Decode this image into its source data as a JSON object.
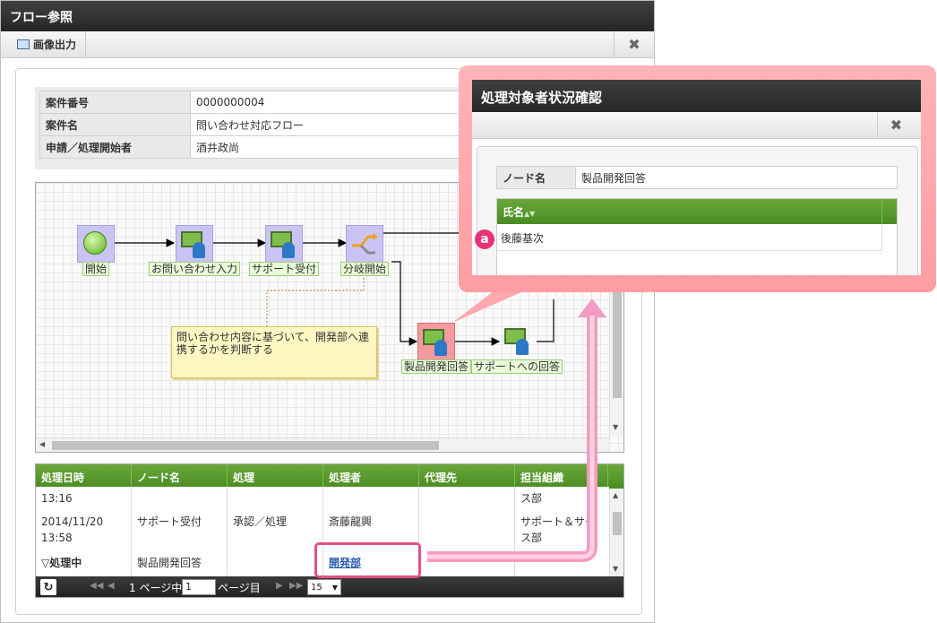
{
  "main_window": {
    "title": "フロー参照",
    "toolbar": {
      "image_output_label": "画像出力",
      "close_symbol": "✖"
    }
  },
  "info_table": [
    {
      "label": "案件番号",
      "value": "0000000004"
    },
    {
      "label": "案件名",
      "value": "問い合わせ対応フロー"
    },
    {
      "label": "申請／処理開始者",
      "value": "酒井政尚"
    }
  ],
  "flow": {
    "nodes": [
      {
        "name": "開始",
        "icon": "start-circle-icon"
      },
      {
        "name": "お問い合わせ入力",
        "icon": "user-task-icon"
      },
      {
        "name": "サポート受付",
        "icon": "user-task-icon"
      },
      {
        "name": "分岐開始",
        "icon": "branch-icon"
      },
      {
        "name": "製品開発回答",
        "icon": "user-task-icon",
        "status": "active"
      },
      {
        "name": "サポートへの回答",
        "icon": "user-task-icon"
      }
    ],
    "note": "問い合わせ内容に基づいて、開発部へ連携するかを判断する"
  },
  "history": {
    "columns": [
      "処理日時",
      "ノード名",
      "処理",
      "処理者",
      "代理先",
      "担当組織"
    ],
    "rows": [
      {
        "time": "13:16",
        "time2": "",
        "node": "",
        "action": "",
        "user": "",
        "proxy": "",
        "org": "ス部",
        "org2": ""
      },
      {
        "time": "2014/11/20",
        "time2": "13:58",
        "node": "サポート受付",
        "action": "承認／処理",
        "user": "斎藤龍興",
        "proxy": "",
        "org": "サポート＆サー",
        "org2": "ス部"
      },
      {
        "time": "▽処理中",
        "time2": "",
        "node": "製品開発回答",
        "action": "",
        "user": "開発部",
        "proxy": "",
        "org": "",
        "org2": ""
      }
    ]
  },
  "pager": {
    "refresh_icon": "refresh-icon",
    "first": "◀◀",
    "prev": "◀",
    "page_prefix": "1 ページ中",
    "page_value": "1",
    "page_suffix": "ページ目",
    "next": "▶",
    "last": "▶▶",
    "per_page": "15",
    "per_page_arrow": "▼"
  },
  "popup": {
    "title": "処理対象者状況確認",
    "close_symbol": "✖",
    "node_label": "ノード名",
    "node_value": "製品開発回答",
    "grid_header": "氏名",
    "sort_icon": "▲▼",
    "rows": [
      "後藤基次"
    ],
    "badge": "a"
  },
  "colors": {
    "accent_green": "#5a9a2e",
    "highlight_pink": "#e4508a",
    "popup_frame": "#ffa8ad"
  }
}
